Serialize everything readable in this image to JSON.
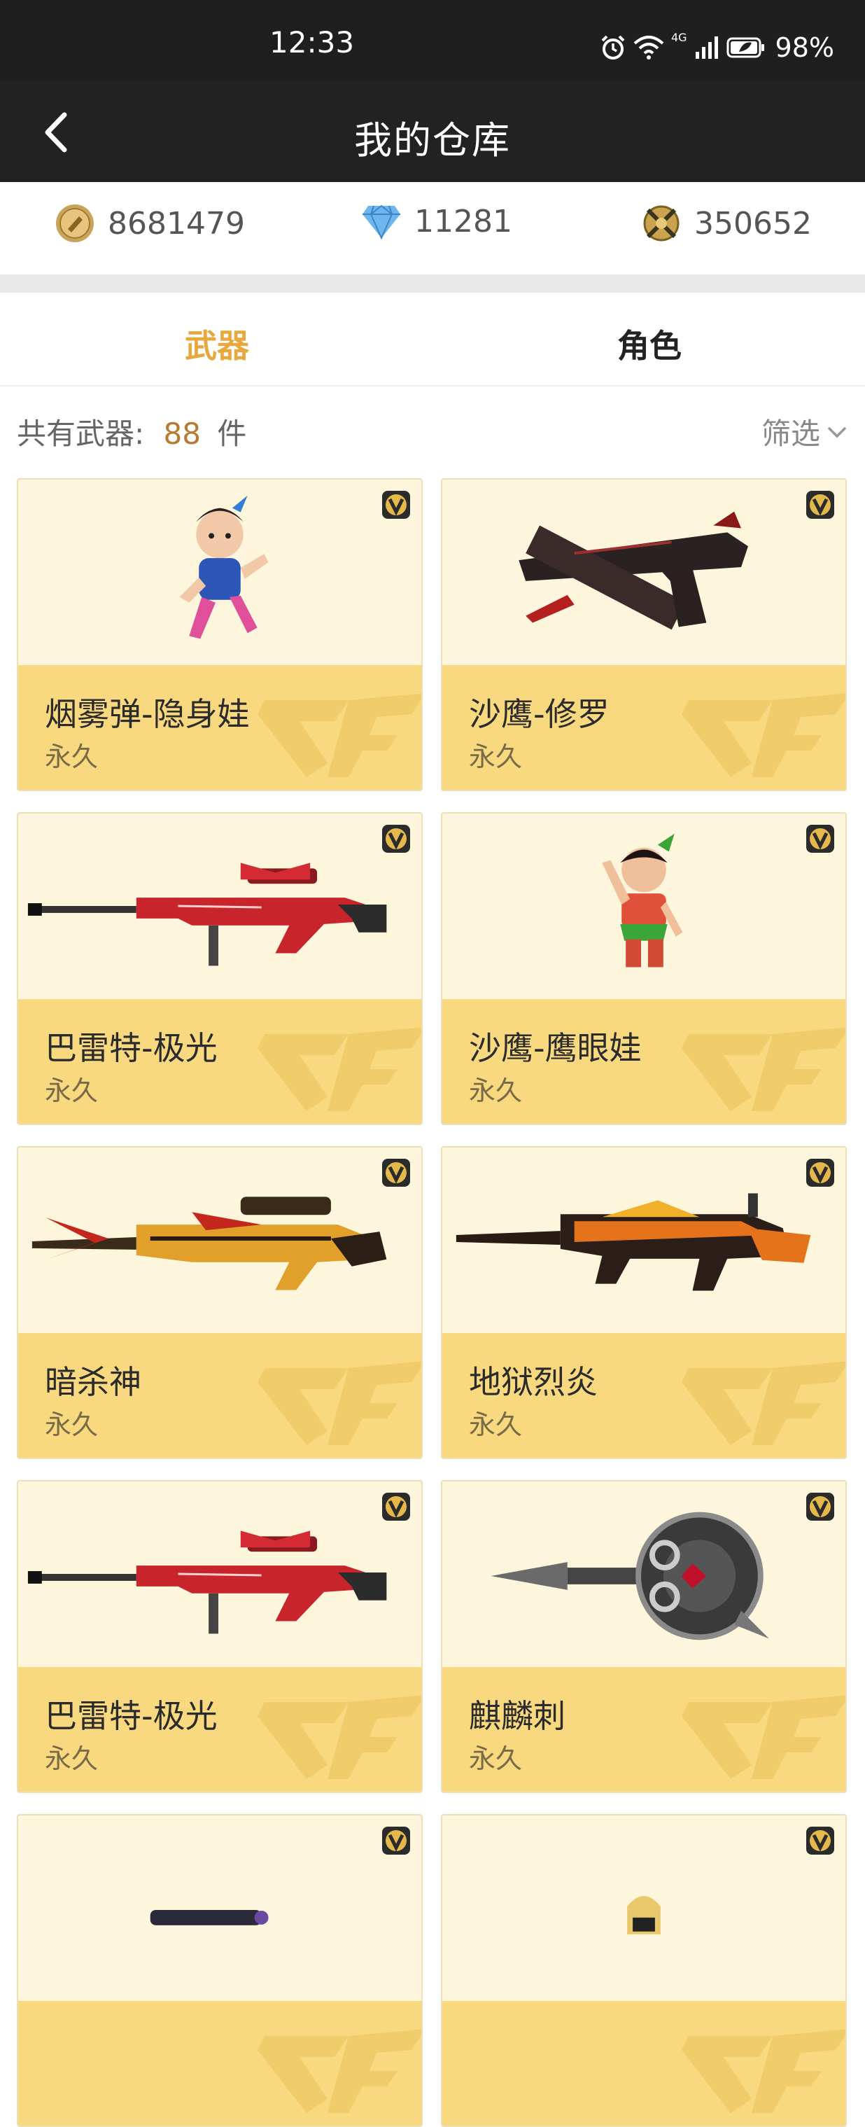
{
  "status": {
    "time": "12:33",
    "battery": "98%",
    "net": "4G"
  },
  "nav": {
    "title": "我的仓库"
  },
  "currencies": [
    {
      "icon": "gold-coin-icon",
      "value": "8681479"
    },
    {
      "icon": "diamond-icon",
      "value": "11281"
    },
    {
      "icon": "crossed-swords-emblem-icon",
      "value": "350652"
    }
  ],
  "tabs": [
    {
      "label": "武器",
      "active": true
    },
    {
      "label": "角色",
      "active": false
    }
  ],
  "summary": {
    "prefix": "共有武器:",
    "count": "88",
    "unit": "件",
    "filter": "筛选"
  },
  "items": [
    {
      "name": "烟雾弹-隐身娃",
      "duration": "永久",
      "art": "doll-blue"
    },
    {
      "name": "沙鹰-修罗",
      "duration": "永久",
      "art": "pistol-dark"
    },
    {
      "name": "巴雷特-极光",
      "duration": "永久",
      "art": "sniper-red"
    },
    {
      "name": "沙鹰-鹰眼娃",
      "duration": "永久",
      "art": "doll-red"
    },
    {
      "name": "暗杀神",
      "duration": "永久",
      "art": "sniper-gold"
    },
    {
      "name": "地狱烈炎",
      "duration": "永久",
      "art": "rifle-flame"
    },
    {
      "name": "巴雷特-极光",
      "duration": "永久",
      "art": "sniper-red"
    },
    {
      "name": "麒麟刺",
      "duration": "永久",
      "art": "knuckle-blade"
    },
    {
      "name": "",
      "duration": "",
      "art": "scope-partial"
    },
    {
      "name": "",
      "duration": "",
      "art": "figure-partial"
    }
  ],
  "colors": {
    "accent": "#e7a93d",
    "card_bg": "#fdf6dc",
    "card_info": "#f8d97f",
    "count": "#b87a30"
  }
}
